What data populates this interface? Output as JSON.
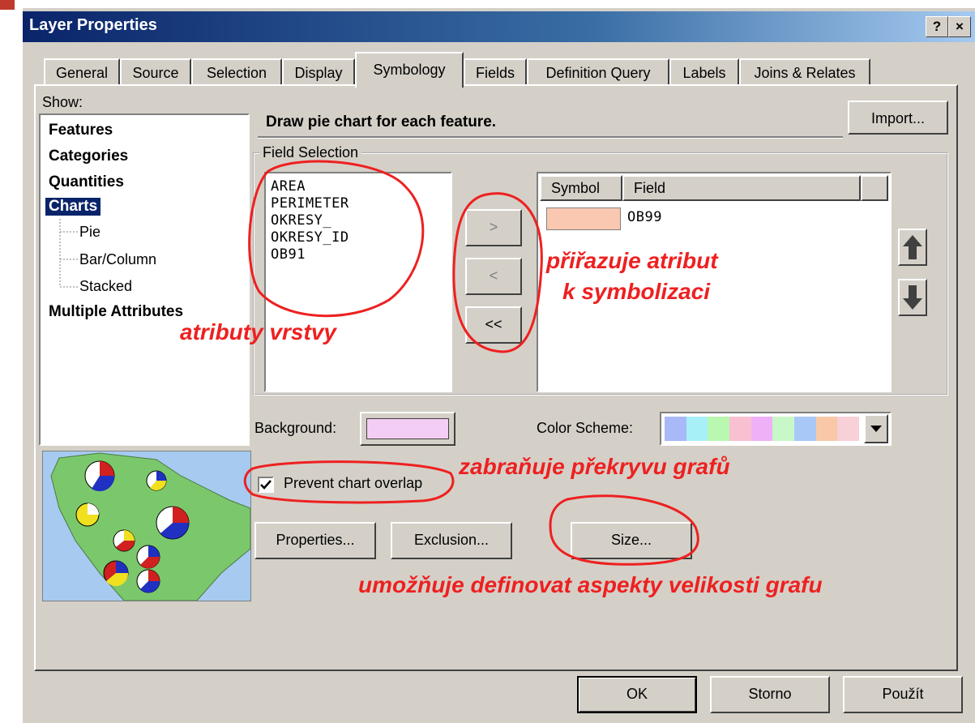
{
  "window": {
    "title": "Layer Properties",
    "help_btn": "?",
    "close_btn": "×"
  },
  "tabs": [
    {
      "label": "General"
    },
    {
      "label": "Source"
    },
    {
      "label": "Selection"
    },
    {
      "label": "Display"
    },
    {
      "label": "Symbology"
    },
    {
      "label": "Fields"
    },
    {
      "label": "Definition Query"
    },
    {
      "label": "Labels"
    },
    {
      "label": "Joins & Relates"
    }
  ],
  "active_tab": "Symbology",
  "show": {
    "label": "Show:",
    "items": [
      "Features",
      "Categories",
      "Quantities",
      "Charts",
      "Multiple Attributes"
    ],
    "chart_types": [
      "Pie",
      "Bar/Column",
      "Stacked"
    ],
    "selected": "Charts"
  },
  "description": "Draw pie chart for each feature.",
  "import_label": "Import...",
  "field_selection": {
    "label": "Field Selection",
    "available_fields": [
      "AREA",
      "PERIMETER",
      "OKRESY_",
      "OKRESY_ID",
      "OB91"
    ],
    "move_right": ">",
    "move_left": "<",
    "move_all_left": "<<",
    "table_headers": [
      "Symbol",
      "Field"
    ],
    "selected_rows": [
      {
        "field": "OB99",
        "color": "#fac8b0"
      }
    ]
  },
  "background_label": "Background:",
  "background_color": "#f3cdf3",
  "color_scheme_label": "Color Scheme:",
  "color_scheme": [
    "#a8b8f8",
    "#a8f0f8",
    "#b8f8b0",
    "#f8c0d0",
    "#f0b0f8",
    "#c8f8c8",
    "#a8c8f8",
    "#f8c8a8",
    "#f8d0d8"
  ],
  "prevent_overlap_label": "Prevent chart overlap",
  "prevent_overlap_checked": true,
  "buttons": {
    "properties": "Properties...",
    "exclusion": "Exclusion...",
    "size": "Size...",
    "ok": "OK",
    "cancel": "Storno",
    "apply": "Použít"
  },
  "annotations": {
    "fields": "atributy vrstvy",
    "assign_line1": "přiřazuje atribut",
    "assign_line2": "k symbolizaci",
    "overlap": "zabraňuje překryvu grafů",
    "size": "umožňuje definovat aspekty velikosti grafu"
  },
  "colors": {
    "annotation": "#ee2020",
    "title_bar": "#0a246a",
    "selection": "#0a246a",
    "dialog": "#d4d0c8"
  }
}
